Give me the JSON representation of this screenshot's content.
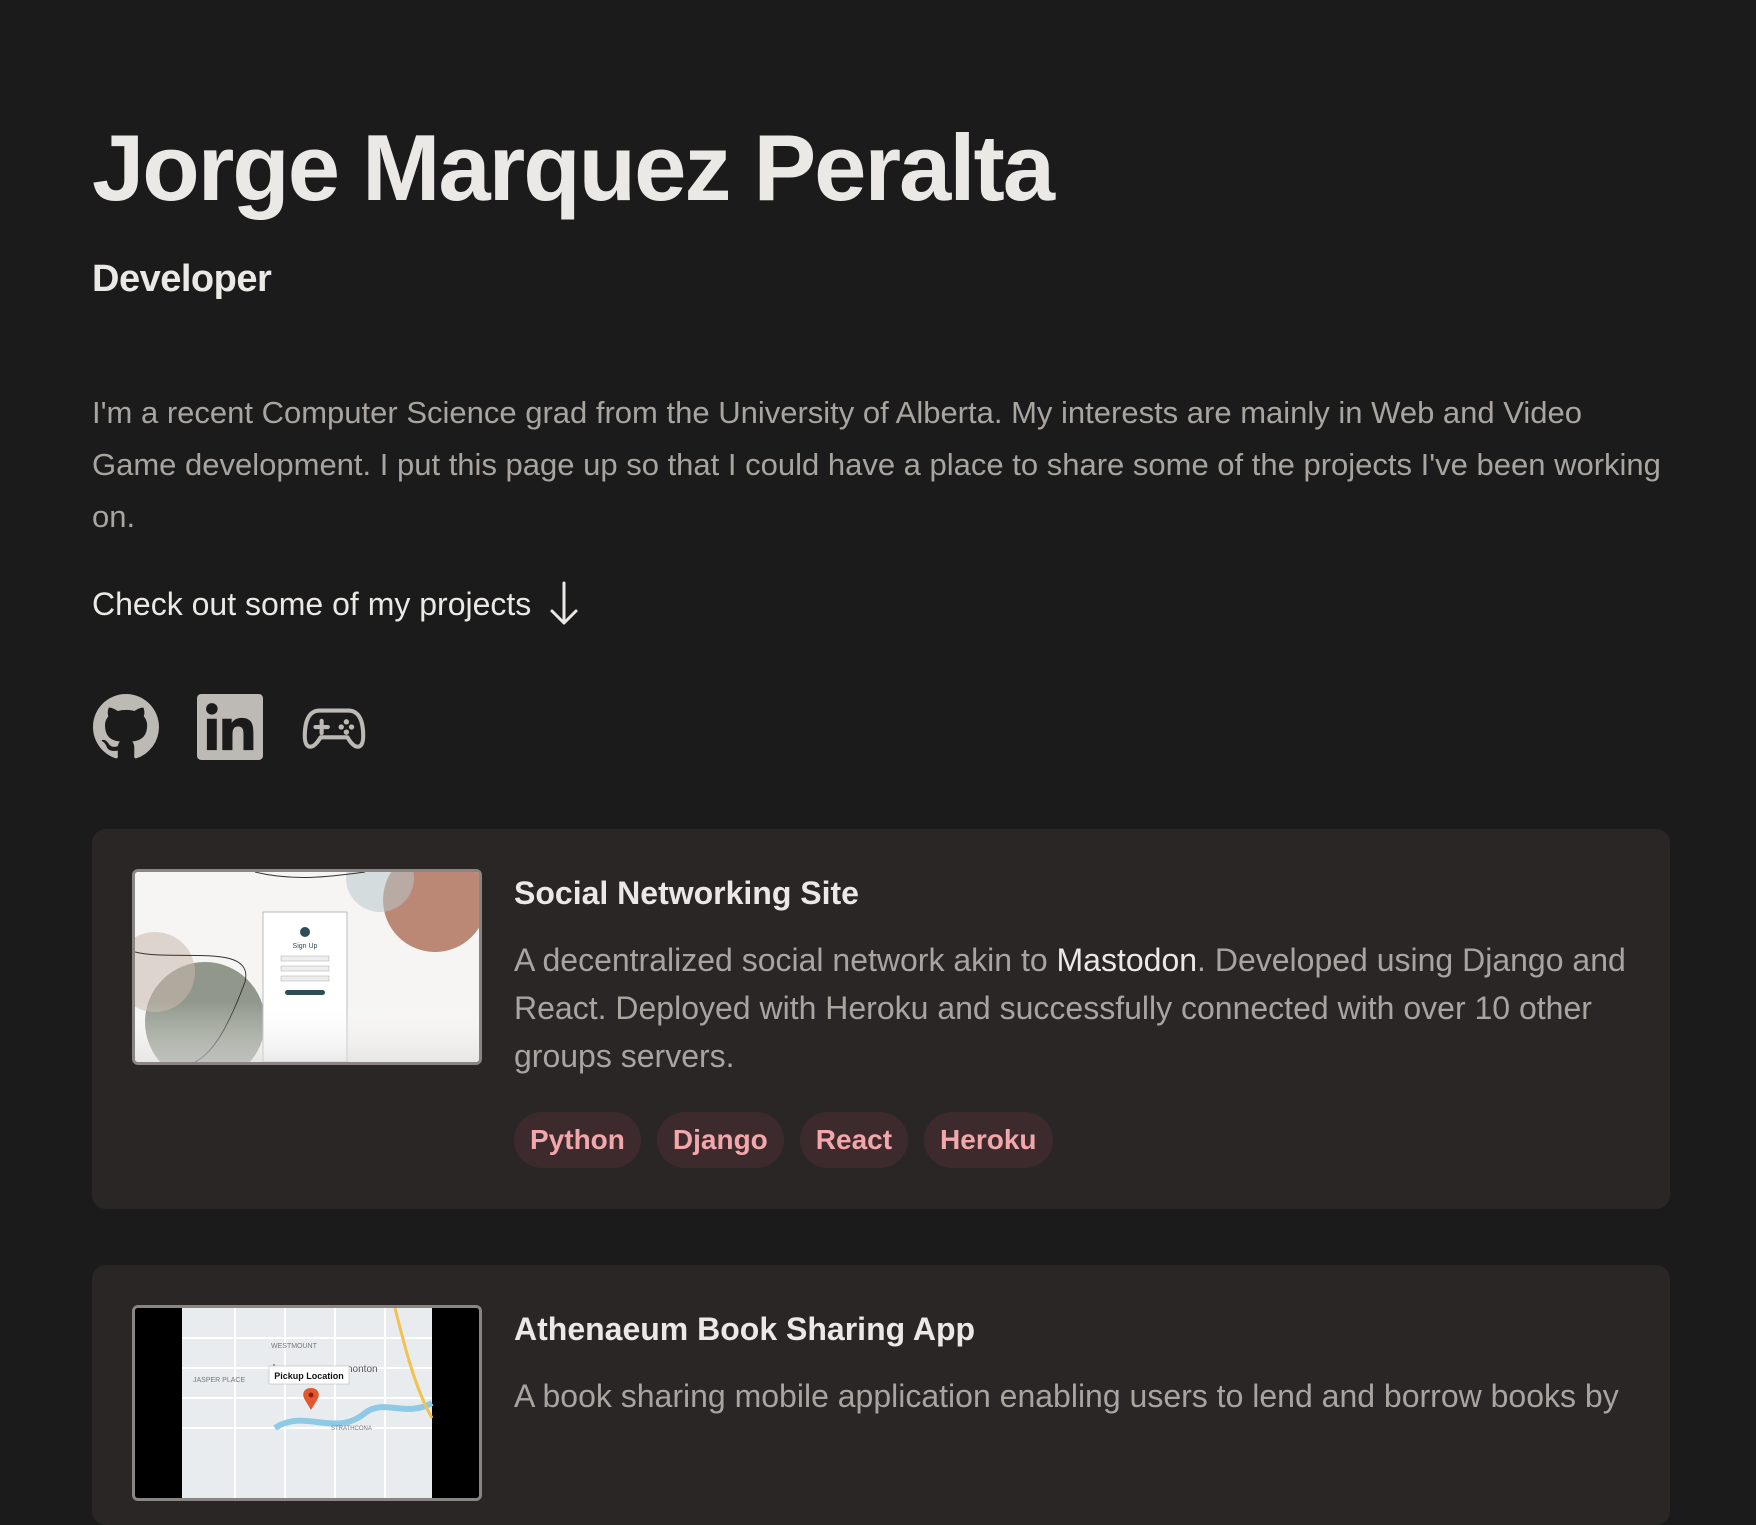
{
  "header": {
    "name": "Jorge Marquez Peralta",
    "role": "Developer",
    "bio": "I'm a recent Computer Science grad from the University of Alberta. My interests are mainly in Web and Video Game development. I put this page up so that I could have a place to share some of the projects I've been working on.",
    "cta": "Check out some of my projects"
  },
  "socials": [
    {
      "icon": "github-icon"
    },
    {
      "icon": "linkedin-icon"
    },
    {
      "icon": "gamepad-icon"
    }
  ],
  "projects": [
    {
      "title": "Social Networking Site",
      "desc_before": "A decentralized social network akin to ",
      "desc_link": "Mastodon",
      "desc_after": ". Developed using Django and React. Deployed with Heroku and successfully connected with over 10 other groups servers.",
      "tags": [
        "Python",
        "Django",
        "React",
        "Heroku"
      ],
      "thumb": {
        "form_title": "Sign Up"
      }
    },
    {
      "title": "Athenaeum Book Sharing App",
      "desc": "A book sharing mobile application enabling users to lend and borrow books by",
      "thumb": {
        "pin_label": "Pickup Location",
        "map_labels": [
          "WESTMOUNT",
          "JASPER PLACE",
          "nonton",
          "STRATHCONA"
        ]
      }
    }
  ],
  "colors": {
    "background": "#1c1b1b",
    "card": "#2a2626",
    "tag_bg": "#3d2a2c",
    "tag_text": "#f2a7ac"
  }
}
